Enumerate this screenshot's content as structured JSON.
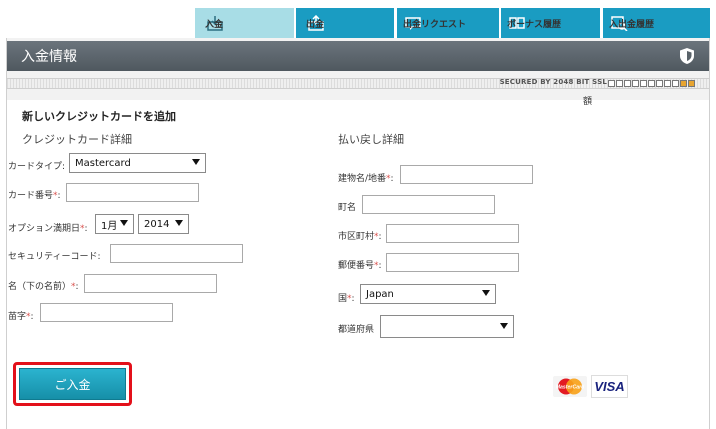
{
  "tabs": [
    {
      "label": "入金",
      "icon": "deposit-icon",
      "active": true
    },
    {
      "label": "出金",
      "icon": "withdraw-icon",
      "active": false
    },
    {
      "label": "出金リクエスト",
      "icon": "withdraw-request-icon",
      "active": false
    },
    {
      "label": "ボーナス履歴",
      "icon": "bonus-history-icon",
      "active": false
    },
    {
      "label": "入出金履歴",
      "icon": "transaction-history-icon",
      "active": false
    }
  ],
  "section": {
    "title": "入金情報"
  },
  "security": {
    "text": "SECURED BY 2048 BIT SSL"
  },
  "amount_label": "額",
  "form": {
    "title": "新しいクレジットカードを追加",
    "card_section_title": "クレジットカード詳細",
    "refund_section_title": "払い戻し詳細",
    "card_type": {
      "label": "カードタイプ:",
      "value": "Mastercard"
    },
    "card_number": {
      "label": "カード番号",
      "required": "*",
      "colon": ":",
      "value": ""
    },
    "expiry": {
      "label": "オプション満期日",
      "required": "*",
      "colon": ":",
      "month": "1月",
      "year": "2014"
    },
    "security_code": {
      "label": "セキュリティーコード:",
      "value": ""
    },
    "first_name": {
      "label": "名（下の名前）",
      "required": "*",
      "colon": ":",
      "value": ""
    },
    "last_name": {
      "label": "苗字",
      "required": "*",
      "colon": ":",
      "value": ""
    },
    "building": {
      "label": "建物名/地番",
      "required": "*",
      "colon": ":",
      "value": ""
    },
    "town": {
      "label": "町名",
      "value": ""
    },
    "city": {
      "label": "市区町村",
      "required": "*",
      "colon": ":",
      "value": ""
    },
    "postal": {
      "label": "郵便番号",
      "required": "*",
      "colon": ":",
      "value": ""
    },
    "country": {
      "label": "国",
      "required": "*",
      "colon": ":",
      "value": "Japan"
    },
    "prefecture": {
      "label": "都道府県",
      "value": ""
    }
  },
  "submit_label": "ご入金",
  "logos": {
    "mastercard": "MasterCard",
    "visa": "VISA"
  },
  "colors": {
    "tab": "#1a9cc2",
    "tab_active": "#a8dde6",
    "button": "#1c9fba",
    "highlight": "#e3101a",
    "required": "#d9534f"
  }
}
